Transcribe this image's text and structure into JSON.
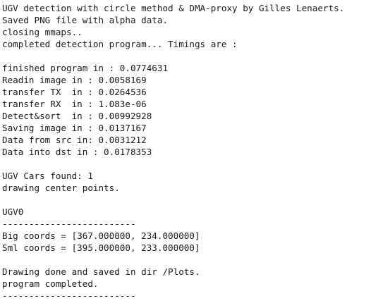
{
  "terminal": {
    "lines": [
      "UGV detection with circle method & DMA-proxy by Gilles Lenaerts.",
      "Saved PNG file with alpha data.",
      "closing mmaps..",
      "completed detection program... Timings are :",
      "",
      "finished program in : 0.0774631",
      "Readin image in : 0.0058169",
      "transfer TX  in : 0.0264536",
      "transfer RX  in : 1.083e-06",
      "Detect&sort  in : 0.00992928",
      "Saving image in : 0.0137167",
      "Data from src in: 0.0031212",
      "Data into dst in : 0.0178353",
      "",
      "UGV Cars found: 1",
      "drawing center points.",
      "",
      "UGV0",
      "-------------------------",
      "Big coords = [367.000000, 234.000000]",
      "Sml coords = [395.000000, 233.000000]",
      "",
      "Drawing done and saved in dir /Plots.",
      "program completed.",
      "-------------------------"
    ]
  }
}
